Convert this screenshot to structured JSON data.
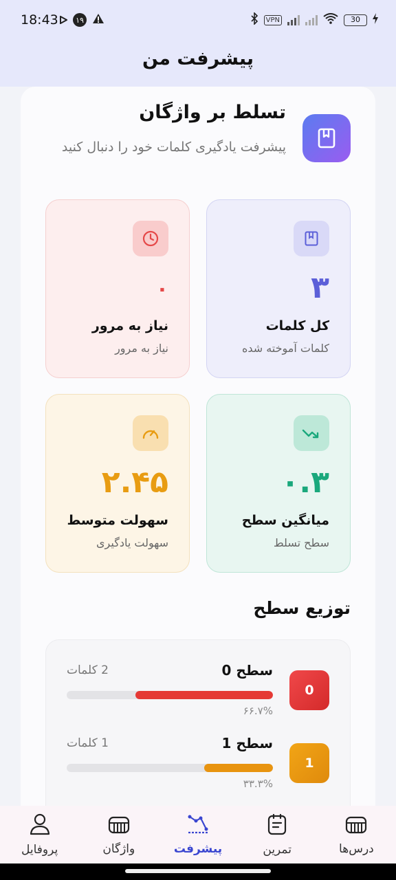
{
  "status_bar": {
    "time": "18:43",
    "notif_badge": "۱۹",
    "vpn": "VPN",
    "battery": "30"
  },
  "app_bar": {
    "title": "پیشرفت من"
  },
  "header": {
    "title": "تسلط بر واژگان",
    "subtitle": "پیشرفت یادگیری کلمات خود را دنبال کنید",
    "icon": "book-icon"
  },
  "stats": {
    "total": {
      "value": "۳",
      "label": "کل کلمات",
      "sub": "کلمات آموخته شده",
      "icon": "book-icon",
      "color": "#5b5fd8"
    },
    "review": {
      "value": "۰",
      "label": "نیاز به مرور",
      "sub": "نیاز به مرور",
      "icon": "clock-icon",
      "color": "#e54848"
    },
    "level": {
      "value": "۰.۳",
      "label": "میانگین سطح",
      "sub": "سطح تسلط",
      "icon": "trend-icon",
      "color": "#1aa87c"
    },
    "ease": {
      "value": "۲.۴۵",
      "label": "سهولت متوسط",
      "sub": "سهولت یادگیری",
      "icon": "gauge-icon",
      "color": "#e89c12"
    }
  },
  "distribution": {
    "title": "توزیع سطح",
    "levels": [
      {
        "badge": "0",
        "name": "سطح 0",
        "count": "2 کلمات",
        "percent_text": "۶۶.۷%",
        "fraction": 0.667,
        "color": "#e53935"
      },
      {
        "badge": "1",
        "name": "سطح 1",
        "count": "1 کلمات",
        "percent_text": "۳۳.۳%",
        "fraction": 0.333,
        "color": "#e89410"
      }
    ]
  },
  "bottom_nav": [
    {
      "label": "درس‌ها",
      "icon": "lessons-icon",
      "active": false
    },
    {
      "label": "تمرین",
      "icon": "practice-icon",
      "active": false
    },
    {
      "label": "پیشرفت",
      "icon": "progress-icon",
      "active": true
    },
    {
      "label": "واژگان",
      "icon": "vocab-icon",
      "active": false
    },
    {
      "label": "پروفایل",
      "icon": "profile-icon",
      "active": false
    }
  ]
}
